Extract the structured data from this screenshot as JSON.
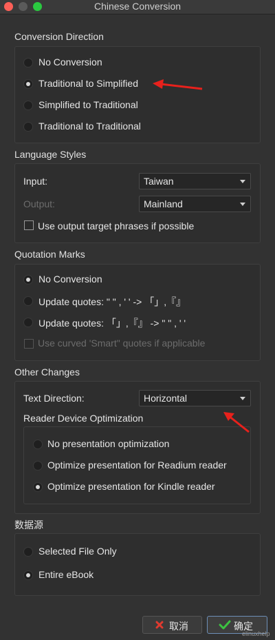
{
  "window": {
    "title": "Chinese Conversion"
  },
  "conversion_direction": {
    "title": "Conversion Direction",
    "options": [
      {
        "label": "No Conversion",
        "selected": false
      },
      {
        "label": "Traditional to Simplified",
        "selected": true
      },
      {
        "label": "Simplified to Traditional",
        "selected": false
      },
      {
        "label": "Traditional to Traditional",
        "selected": false
      }
    ]
  },
  "language_styles": {
    "title": "Language Styles",
    "input_label": "Input:",
    "input_value": "Taiwan",
    "output_label": "Output:",
    "output_value": "Mainland",
    "checkbox_label": "Use output target phrases if possible",
    "checkbox_checked": false
  },
  "quotation_marks": {
    "title": "Quotation Marks",
    "options": [
      {
        "label": "No Conversion",
        "selected": true
      },
      {
        "label": "Update quotes:  \" \" , ' '  -> 「」,『』",
        "selected": false
      },
      {
        "label": "Update quotes:  「」,『』 -> \" \" , ' '",
        "selected": false
      }
    ],
    "checkbox_label": "Use curved 'Smart\" quotes if applicable",
    "checkbox_enabled": false
  },
  "other_changes": {
    "title": "Other Changes",
    "text_direction_label": "Text Direction:",
    "text_direction_value": "Horizontal",
    "reader_title": "Reader Device Optimization",
    "reader_options": [
      {
        "label": "No presentation optimization",
        "selected": false
      },
      {
        "label": "Optimize presentation for Readium reader",
        "selected": false
      },
      {
        "label": "Optimize presentation for Kindle reader",
        "selected": true
      }
    ]
  },
  "data_source": {
    "title": "数据源",
    "options": [
      {
        "label": "Selected File Only",
        "selected": false
      },
      {
        "label": "Entire eBook",
        "selected": true
      }
    ]
  },
  "buttons": {
    "cancel": "取消",
    "ok": "确定"
  },
  "watermark": "elinuxhelp",
  "colors": {
    "annotation_arrow": "#e8211c",
    "cancel_icon": "#e03a2f",
    "ok_icon": "#3cc341",
    "ok_border": "#6d8fb8"
  }
}
